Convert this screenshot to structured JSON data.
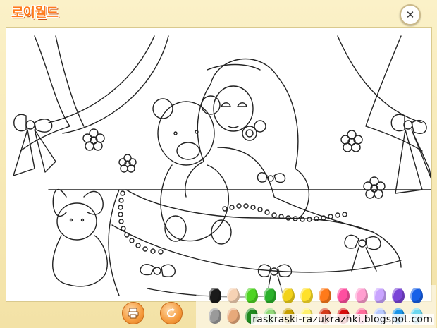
{
  "app": {
    "logo_text": "로이월드"
  },
  "controls": {
    "close_glyph": "✕",
    "tools": [
      {
        "name": "print-button",
        "icon": "printer-icon"
      },
      {
        "name": "reset-button",
        "icon": "refresh-icon"
      }
    ]
  },
  "palette": {
    "row1": [
      "#1a1a1a",
      "#f6d2b4",
      "#4fd423",
      "#2bb12b",
      "#f2d21a",
      "#ffe12b",
      "#ff7a1a",
      "#ff4fa0",
      "#ff9ed0",
      "#c9a4ff",
      "#7a45d8",
      "#1660e8"
    ],
    "row2": [
      "#9a9a9a",
      "#e7a97a",
      "#1f8a1f",
      "#93d97a",
      "#c8a000",
      "#fff16a",
      "#d43a1a",
      "#d80b0b",
      "#ff6a9a",
      "#b7c8ff",
      "#1a95e8",
      "#6ad8f0"
    ]
  },
  "watermark": "raskraski-razukrazhki.blogspot.com"
}
